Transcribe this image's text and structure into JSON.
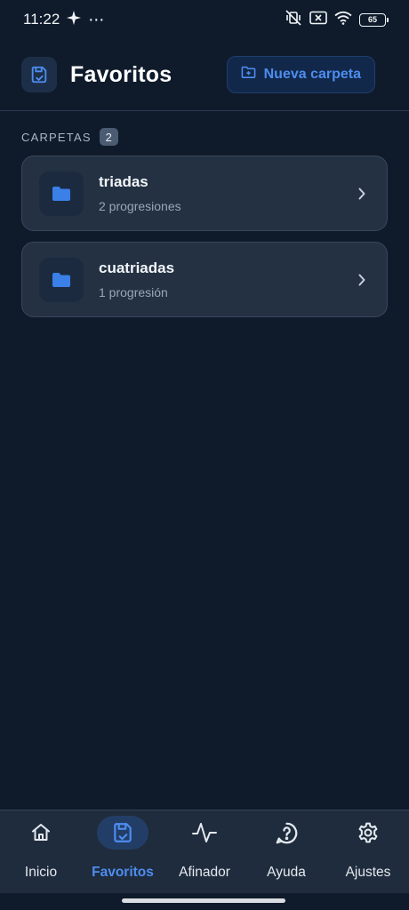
{
  "status_bar": {
    "time": "11:22",
    "dots": "⋯",
    "battery": "65",
    "icons": [
      "sparkle-icon",
      "mute-vibrate-icon",
      "sim-off-icon",
      "wifi-icon",
      "battery-icon"
    ]
  },
  "header": {
    "title": "Favoritos",
    "new_folder_label": "Nueva carpeta",
    "icon": "save-icon"
  },
  "section": {
    "title": "CARPETAS",
    "count": "2"
  },
  "folders": [
    {
      "name": "triadas",
      "subtitle": "2 progresiones"
    },
    {
      "name": "cuatriadas",
      "subtitle": "1 progresión"
    }
  ],
  "nav": {
    "items": [
      {
        "label": "Inicio",
        "icon": "home-icon"
      },
      {
        "label": "Favoritos",
        "icon": "save-icon",
        "active": true
      },
      {
        "label": "Afinador",
        "icon": "pulse-icon"
      },
      {
        "label": "Ayuda",
        "icon": "help-icon"
      },
      {
        "label": "Ajustes",
        "icon": "gear-icon"
      }
    ]
  },
  "colors": {
    "background": "#0f1b2b",
    "accent": "#4d8df0",
    "card": "#233143",
    "nav_bar": "#1f2c3d"
  }
}
